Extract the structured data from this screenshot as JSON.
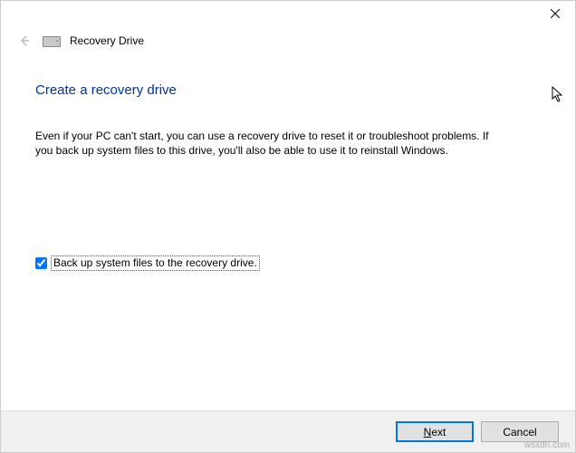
{
  "window": {
    "title": "Recovery Drive"
  },
  "page": {
    "heading": "Create a recovery drive",
    "body": "Even if your PC can't start, you can use a recovery drive to reset it or troubleshoot problems. If you back up system files to this drive, you'll also be able to use it to reinstall Windows."
  },
  "checkbox": {
    "checked": true,
    "label": "Back up system files to the recovery drive."
  },
  "buttons": {
    "next_prefix": "N",
    "next_rest": "ext",
    "cancel": "Cancel"
  },
  "watermark": "wsxdn.com"
}
